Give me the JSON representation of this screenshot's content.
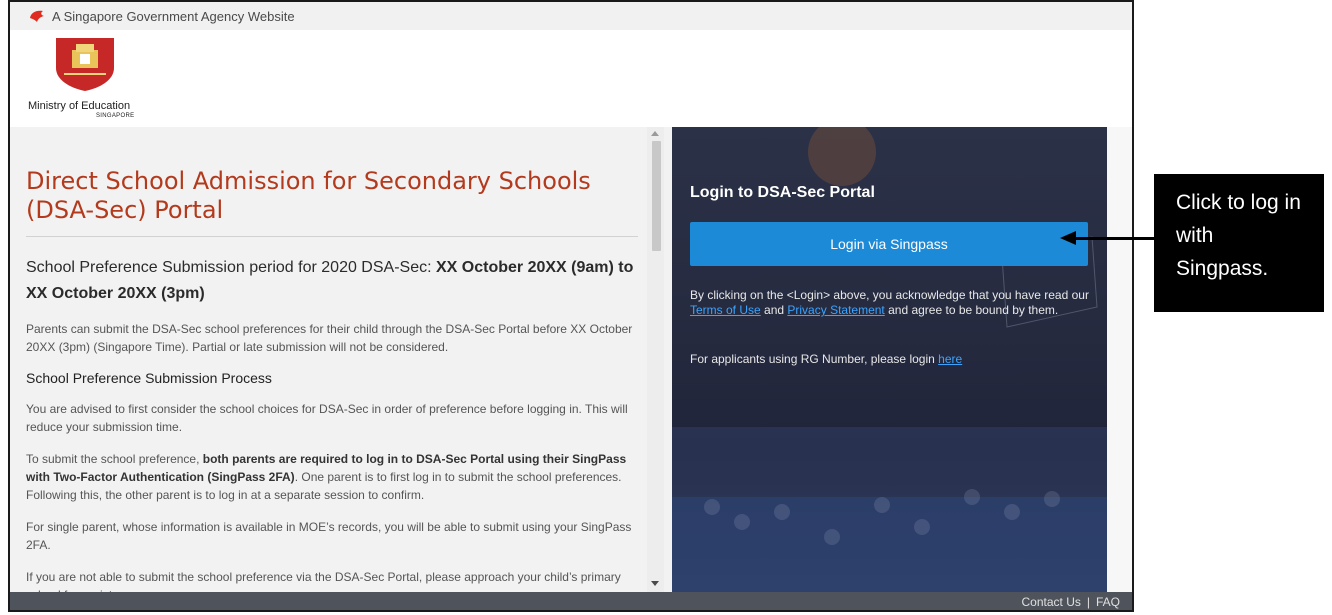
{
  "gov_bar": {
    "text": "A Singapore Government Agency Website",
    "icon": "lion-head-icon"
  },
  "header": {
    "agency_name": "Ministry of Education",
    "agency_sub": "SINGAPORE",
    "logo": "moe-crest-icon"
  },
  "main": {
    "title": "Direct School Admission for Secondary Schools (DSA-Sec) Portal",
    "period_prefix": "School Preference Submission period for 2020 DSA-Sec: ",
    "period_dates": "XX October 20XX (9am) to XX October 20XX (3pm)",
    "intro": "Parents can submit the DSA-Sec school preferences for their child through the DSA-Sec Portal before XX October 20XX (3pm) (Singapore Time). Partial or late submission will not be considered.",
    "process_heading": "School Preference Submission Process",
    "advice": "You are advised to first consider the school choices for DSA-Sec in order of preference before logging in. This will reduce your submission time.",
    "both_parents_prefix": "To submit the school preference, ",
    "both_parents_bold": "both parents are required to log in to DSA-Sec Portal using their SingPass with Two-Factor Authentication (SingPass 2FA)",
    "both_parents_suffix": ". One parent is to first log in to submit the school preferences. Following this, the other parent is to log in at a separate session to confirm.",
    "single_parent": "For single parent, whose information is available in MOE’s records, you will be able to submit using your SingPass 2FA.",
    "not_able": "If you are not able to submit the school preference via the DSA-Sec Portal, please approach your child’s primary school for assistance."
  },
  "login": {
    "title": "Login to DSA-Sec Portal",
    "button": "Login via Singpass",
    "ack_prefix": "By clicking on the <Login> above, you acknowledge that you have read our ",
    "terms_link": "Terms of Use",
    "ack_and": " and ",
    "privacy_link": "Privacy Statement",
    "ack_suffix": " and agree to be bound by them.",
    "rg_text": "For applicants using RG Number, please login ",
    "rg_link": "here"
  },
  "footer": {
    "contact": "Contact Us",
    "separator": "|",
    "faq": "FAQ"
  },
  "annotation": {
    "text": "Click to log in with Singpass."
  },
  "colors": {
    "title_red": "#b33a1c",
    "button_blue": "#1c8ad6",
    "link_blue": "#3aa4ff",
    "footer_gray": "#4f545c"
  }
}
